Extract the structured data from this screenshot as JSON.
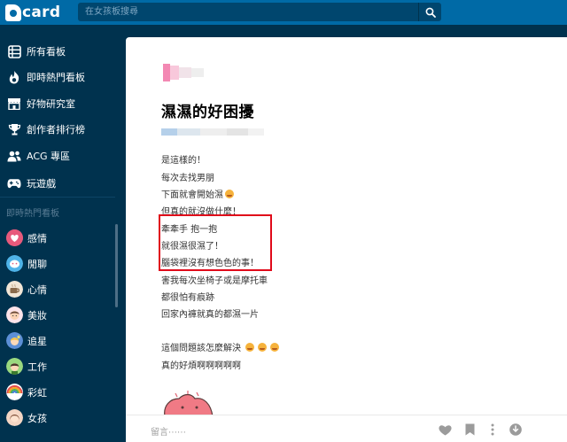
{
  "app": {
    "logo_text": "card"
  },
  "search": {
    "placeholder": "在女孩板搜尋"
  },
  "sidebar": {
    "items": [
      {
        "label": "所有看板",
        "icon": "list-icon"
      },
      {
        "label": "即時熱門看板",
        "icon": "fire-icon"
      },
      {
        "label": "好物研究室",
        "icon": "store-icon"
      },
      {
        "label": "創作者排行榜",
        "icon": "trophy-icon"
      },
      {
        "label": "ACG 專區",
        "icon": "users-icon"
      },
      {
        "label": "玩遊戲",
        "icon": "gamepad-icon"
      }
    ],
    "section_title": "即時熱門看板",
    "boards": [
      {
        "label": "感情",
        "color": "#e75a7c"
      },
      {
        "label": "閒聊",
        "color": "#4eb3e8"
      },
      {
        "label": "心情",
        "color": "#8a6a4b"
      },
      {
        "label": "美妝",
        "color": "#f5a3b8"
      },
      {
        "label": "追星",
        "color": "#5c8fd6"
      },
      {
        "label": "工作",
        "color": "#6cbf5a"
      },
      {
        "label": "彩虹",
        "color": "#e44d4d"
      },
      {
        "label": "女孩",
        "color": "#d9a37a"
      }
    ]
  },
  "post": {
    "title": "濕濕的好困擾",
    "lines": [
      "是這樣的！",
      "每次去找男朋",
      "下面就會開始濕",
      "但真的就沒做什麼！",
      "牽牽手 抱一抱",
      "就很濕很濕了！",
      "腦袋裡沒有想色色的事！",
      "害我每次坐椅子或是摩托車",
      "都很怕有痕跡",
      "回家內褲就真的都濕一片",
      "",
      "這個問題該怎麼解決",
      "真的好煩啊啊啊啊啊"
    ]
  },
  "bottom": {
    "comment_placeholder": "留言⋯⋯"
  },
  "colors": {
    "topbar": "#006aa6",
    "sidebar": "#00324e",
    "highlight": "#e00a1a"
  }
}
